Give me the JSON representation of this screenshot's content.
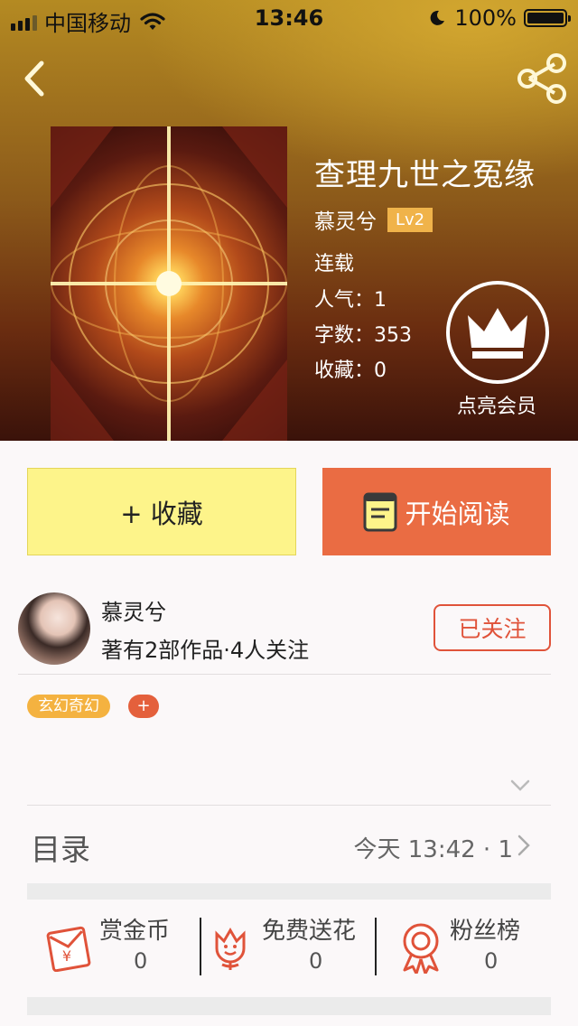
{
  "status_bar": {
    "carrier": "中国移动",
    "time": "13:46",
    "battery": "100%"
  },
  "book": {
    "title": "查理九世之冤缘",
    "author": "慕灵兮",
    "level": "Lv2",
    "status": "连载",
    "popularity": "人气：1",
    "word_count": "字数：353",
    "collections": "收藏：0"
  },
  "vip": {
    "label": "点亮会员"
  },
  "buttons": {
    "collect": "+ 收藏",
    "read": "开始阅读"
  },
  "author_card": {
    "name": "慕灵兮",
    "stats": "著有2部作品·4人关注",
    "follow": "已关注"
  },
  "tags": [
    {
      "label": "玄幻奇幻"
    }
  ],
  "tag_add": "+",
  "toc": {
    "title": "目录",
    "latest": "今天 13:42 · 1"
  },
  "actions": [
    {
      "label": "赏金币",
      "count": "0",
      "icon": "red-envelope-yen-icon"
    },
    {
      "label": "免费送花",
      "count": "0",
      "icon": "flower-icon"
    },
    {
      "label": "粉丝榜",
      "count": "0",
      "icon": "award-ribbon-icon"
    }
  ],
  "colors": {
    "accent_orange": "#ea6c43",
    "collect_yellow": "#fdf48a",
    "tag_yellow": "#f4b240",
    "follow_red": "#e0533a"
  }
}
